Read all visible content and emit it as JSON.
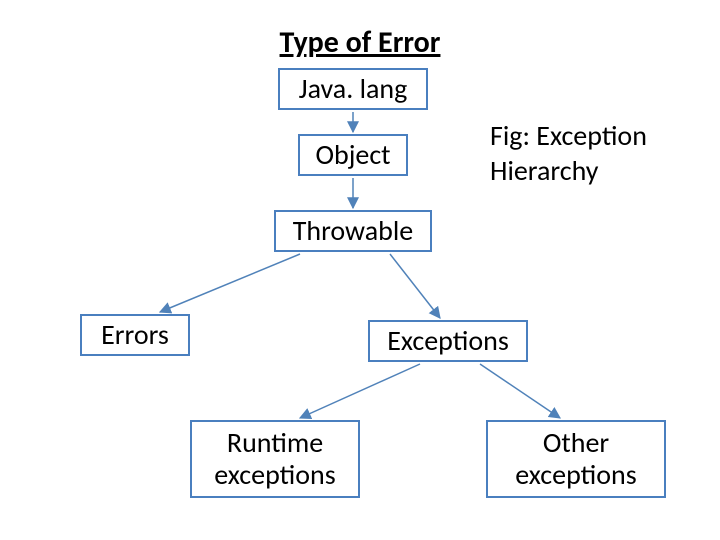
{
  "title": "Type of Error",
  "caption": "Fig: Exception Hierarchy",
  "nodes": {
    "javalang": "Java. lang",
    "object": "Object",
    "throwable": "Throwable",
    "errors": "Errors",
    "exceptions": "Exceptions",
    "runtime": "Runtime exceptions",
    "other": "Other exceptions"
  },
  "colors": {
    "border": "#4a7fbf",
    "arrow": "#5082b9"
  }
}
